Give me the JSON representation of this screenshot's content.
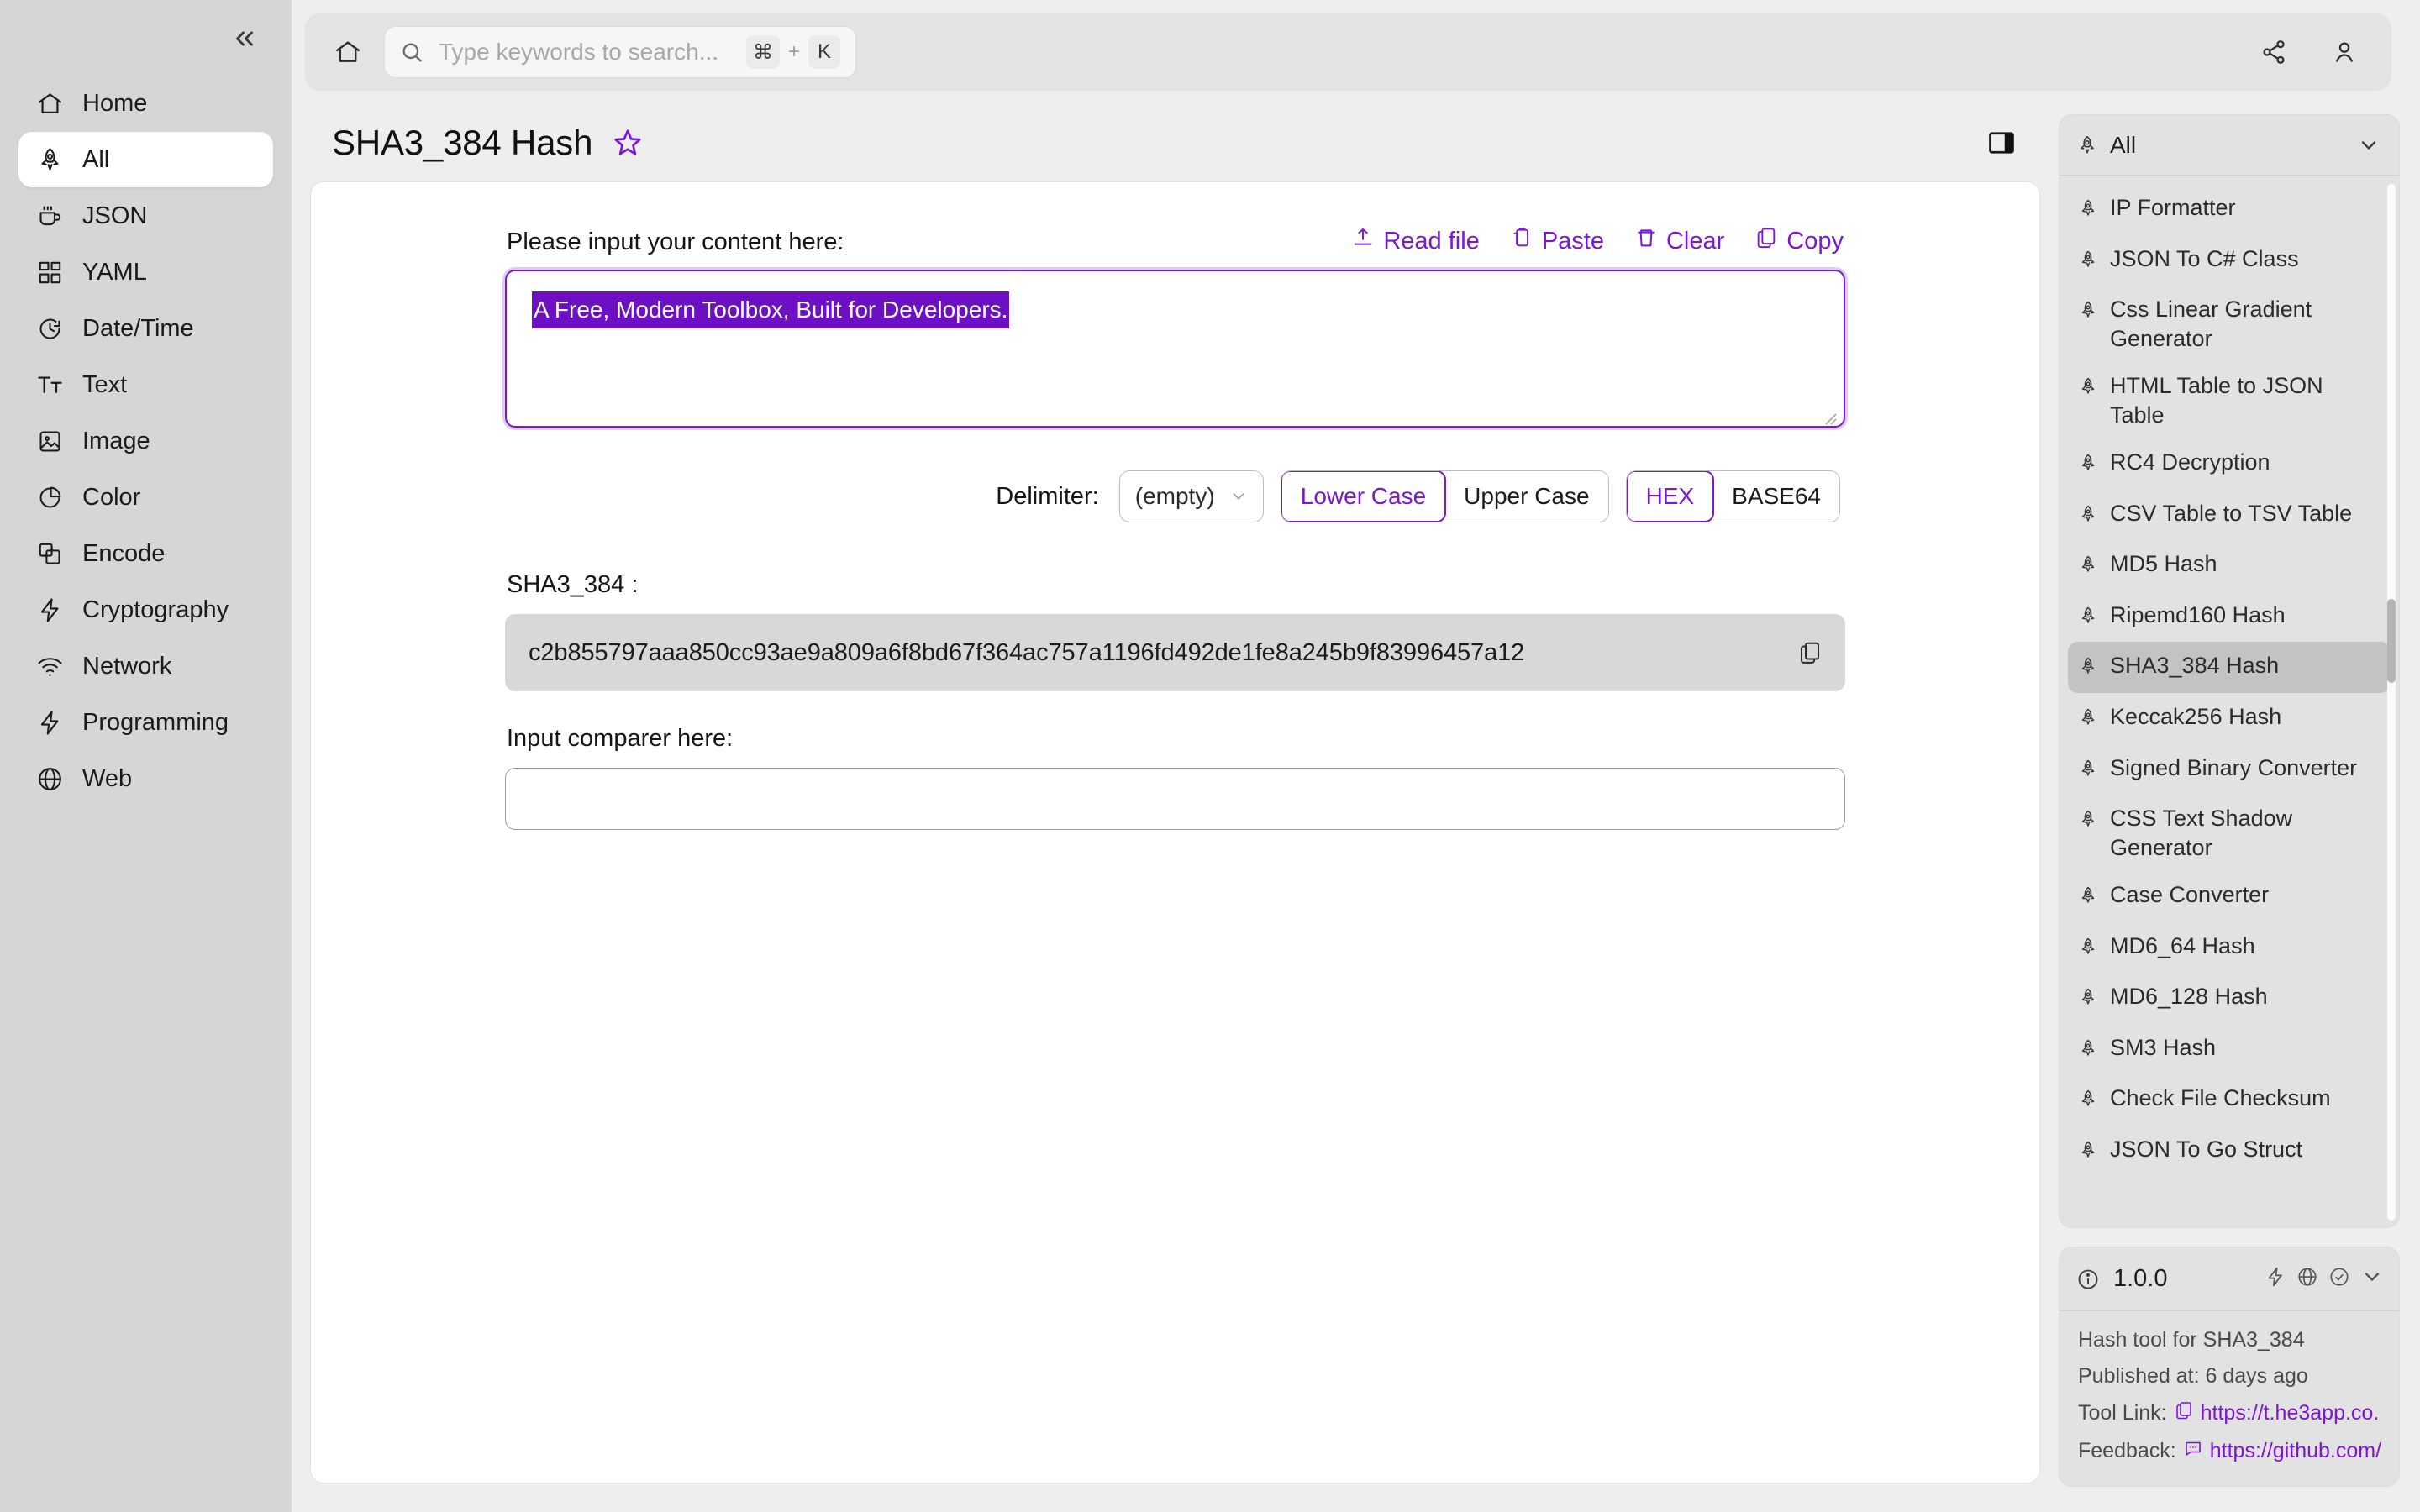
{
  "colors": {
    "accent": "#7b16d9",
    "selection_bg": "#6d10c4",
    "sidebar_bg": "#d6d6d6",
    "page_bg": "#eeeeee",
    "output_bg": "#d8d8d8"
  },
  "sidebar": {
    "collapse_label": "«",
    "items": [
      {
        "label": "Home",
        "icon": "home-icon",
        "active": false
      },
      {
        "label": "All",
        "icon": "rocket-icon",
        "active": true
      },
      {
        "label": "JSON",
        "icon": "cup-icon",
        "active": false
      },
      {
        "label": "YAML",
        "icon": "grid-icon",
        "active": false
      },
      {
        "label": "Date/Time",
        "icon": "clock-icon",
        "active": false
      },
      {
        "label": "Text",
        "icon": "text-icon",
        "active": false
      },
      {
        "label": "Image",
        "icon": "image-icon",
        "active": false
      },
      {
        "label": "Color",
        "icon": "pie-chart-icon",
        "active": false
      },
      {
        "label": "Encode",
        "icon": "layers-icon",
        "active": false
      },
      {
        "label": "Cryptography",
        "icon": "bolt-icon",
        "active": false
      },
      {
        "label": "Network",
        "icon": "wifi-icon",
        "active": false
      },
      {
        "label": "Programming",
        "icon": "bolt-icon",
        "active": false
      },
      {
        "label": "Web",
        "icon": "globe-icon",
        "active": false
      }
    ]
  },
  "topbar": {
    "home_icon": "home-icon",
    "search": {
      "placeholder": "Type keywords to search...",
      "value": "",
      "shortcut_key1": "⌘",
      "shortcut_plus": "+",
      "shortcut_key2": "K"
    },
    "share_icon": "share-icon",
    "account_icon": "user-icon"
  },
  "page": {
    "title": "SHA3_384 Hash",
    "favorite_icon": "star-icon",
    "panel_toggle_icon": "panel-right-icon"
  },
  "tool": {
    "input_label": "Please input your content here:",
    "actions": [
      {
        "label": "Read file",
        "icon": "upload-icon"
      },
      {
        "label": "Paste",
        "icon": "paste-icon"
      },
      {
        "label": "Clear",
        "icon": "trash-icon"
      },
      {
        "label": "Copy",
        "icon": "copy-icon"
      }
    ],
    "input_value": "A Free, Modern Toolbox, Built for Developers.",
    "delimiter_label": "Delimiter:",
    "delimiter_value": "(empty)",
    "case_options": [
      {
        "label": "Lower Case",
        "selected": true
      },
      {
        "label": "Upper Case",
        "selected": false
      }
    ],
    "encoding_options": [
      {
        "label": "HEX",
        "selected": true
      },
      {
        "label": "BASE64",
        "selected": false
      }
    ],
    "output_label": "SHA3_384 :",
    "output_value": "c2b855797aaa850cc93ae9a809a6f8bd67f364ac757a1196fd492de1fe8a245b9f83996457a12",
    "output_copy_icon": "copy-icon",
    "comparer_label": "Input comparer here:",
    "comparer_value": "",
    "comparer_placeholder": ""
  },
  "right_panel": {
    "header": {
      "title": "All",
      "icon": "rocket-icon",
      "caret_icon": "chevron-down-icon"
    },
    "items": [
      {
        "label": "IP Formatter",
        "active": false
      },
      {
        "label": "JSON To C# Class",
        "active": false
      },
      {
        "label": "Css Linear Gradient Generator",
        "active": false
      },
      {
        "label": "HTML Table to JSON Table",
        "active": false
      },
      {
        "label": "RC4 Decryption",
        "active": false
      },
      {
        "label": "CSV Table to TSV Table",
        "active": false
      },
      {
        "label": "MD5 Hash",
        "active": false
      },
      {
        "label": "Ripemd160 Hash",
        "active": false
      },
      {
        "label": "SHA3_384 Hash",
        "active": true
      },
      {
        "label": "Keccak256 Hash",
        "active": false
      },
      {
        "label": "Signed Binary Converter",
        "active": false
      },
      {
        "label": "CSS Text Shadow Generator",
        "active": false
      },
      {
        "label": "Case Converter",
        "active": false
      },
      {
        "label": "MD6_64 Hash",
        "active": false
      },
      {
        "label": "MD6_128 Hash",
        "active": false
      },
      {
        "label": "SM3 Hash",
        "active": false
      },
      {
        "label": "Check File Checksum",
        "active": false
      },
      {
        "label": "JSON To Go Struct",
        "active": false
      }
    ],
    "info": {
      "info_icon": "info-icon",
      "version": "1.0.0",
      "header_icons": [
        "bolt-icon",
        "globe-icon",
        "check-circle-icon",
        "chevron-down-icon"
      ],
      "description": "Hash tool for SHA3_384",
      "published": "Published at: 6 days ago",
      "tool_link_label": "Tool Link:",
      "tool_link_value": "https://t.he3app.co...",
      "tool_link_icon": "copy-icon",
      "feedback_label": "Feedback:",
      "feedback_value": "https://github.com/...",
      "feedback_icon": "comment-icon"
    }
  }
}
